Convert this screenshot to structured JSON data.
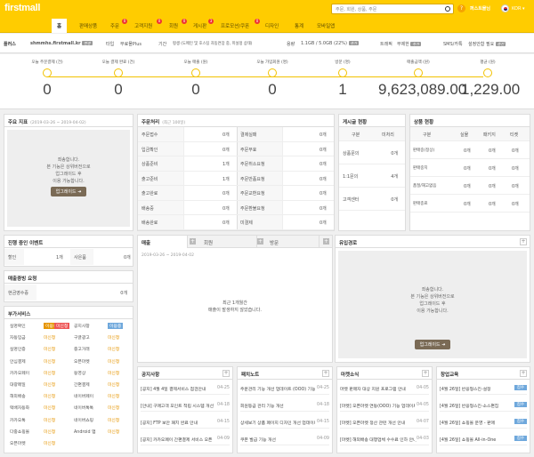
{
  "header": {
    "logo": "firstmall",
    "search_placeholder": "주문, 회원, 상품, 주문",
    "help": "?",
    "user": "퍼스트몰님",
    "lang": "KOR ▾",
    "brand_color": "#ffcc00"
  },
  "nav": [
    {
      "label": "홈"
    },
    {
      "label": "판매상품"
    },
    {
      "label": "주문",
      "badge": "0"
    },
    {
      "label": "고객지원",
      "badge": "0"
    },
    {
      "label": "회원",
      "badge": "0"
    },
    {
      "label": "게시판",
      "badge": "3"
    },
    {
      "label": "프로모션/쿠폰",
      "badge": "0"
    },
    {
      "label": "디자인"
    },
    {
      "label": "통계"
    },
    {
      "label": "모바일앱"
    }
  ],
  "info": {
    "plan": "플러스",
    "domain": "shmmhs.firstmall.kr",
    "domain_tag": "변경",
    "type_label": "타입",
    "type_value": "무료몰Plus",
    "period_label": "기간",
    "period_value": "평생 (도메인 및 호스팅 자동연장 중, 미설정 상태)",
    "capacity_label": "용량",
    "capacity_value": "1.1GB / 5.0GB (22%)",
    "capacity_tag": "추가",
    "traffic_label": "트래픽",
    "traffic_value": "무제한",
    "traffic_tag": "추가",
    "sms_label": "SMS/카톡",
    "sms_value": "설정안함 필요",
    "sms_tag": "충전"
  },
  "stats": [
    {
      "label": "오늘 주문결제 (건)",
      "value": "0"
    },
    {
      "label": "오늘 결제 완료 (건)",
      "value": "0"
    },
    {
      "label": "오늘 매출 (원)",
      "value": "0"
    },
    {
      "label": "오늘 가입회원 (명)",
      "value": "0"
    },
    {
      "label": "방문 (명)",
      "value": "1"
    },
    {
      "label": "매출금액 (원)",
      "value": "9,623,089.00"
    },
    {
      "label": "평균 (원)",
      "value": "1,229.00"
    }
  ],
  "upgrade": {
    "msg1": "죄송합니다.",
    "msg2": "본 기능은 상위버전으로",
    "msg3": "업그레이드 후",
    "msg4": "이용 가능합니다.",
    "button": "업그레이드 ➜"
  },
  "main_metrics": {
    "title": "주요 지표",
    "date": "(2019-03-26 ~ 2019-04-02)"
  },
  "order_process": {
    "title": "주문처리",
    "subtitle": "(최근 100일)",
    "left": [
      {
        "label": "주문접수",
        "value": "0개"
      },
      {
        "label": "입금확인",
        "value": "0개"
      },
      {
        "label": "상품준비",
        "value": "1개"
      },
      {
        "label": "출고준비",
        "value": "1개"
      },
      {
        "label": "출고완료",
        "value": "0개"
      },
      {
        "label": "배송중",
        "value": "0개"
      },
      {
        "label": "배송완료",
        "value": "0개"
      }
    ],
    "right": [
      {
        "label": "결제실패",
        "value": "0개"
      },
      {
        "label": "주문무효",
        "value": "0개"
      },
      {
        "label": "주문취소요청",
        "value": "0개"
      },
      {
        "label": "주문반품요청",
        "value": "0개"
      },
      {
        "label": "주문교환요청",
        "value": "0개"
      },
      {
        "label": "주문환불요청",
        "value": "0개"
      },
      {
        "label": "미결제",
        "value": "0개"
      }
    ]
  },
  "board_status": {
    "title": "게시글 현황",
    "col1": "구분",
    "col2": "미처리",
    "rows": [
      {
        "label": "상품문의",
        "value": "0개"
      },
      {
        "label": "1:1문의",
        "value": "4개"
      },
      {
        "label": "고객센터",
        "value": "0개"
      }
    ]
  },
  "product_status": {
    "title": "상품 현황",
    "cols": [
      "구분",
      "실물",
      "패키지",
      "티켓"
    ],
    "rows": [
      {
        "label": "판매중(정상)",
        "a": "0개",
        "b": "0개",
        "c": "0개"
      },
      {
        "label": "판매중지",
        "a": "0개",
        "b": "0개",
        "c": "0개"
      },
      {
        "label": "품절/재고없음",
        "a": "0개",
        "b": "0개",
        "c": "0개"
      },
      {
        "label": "판매종료",
        "a": "0개",
        "b": "0개",
        "c": "0개"
      }
    ]
  },
  "events": {
    "title": "진행 중인 이벤트",
    "rows": [
      {
        "label": "할인",
        "value": "1개"
      },
      {
        "label": "사은품",
        "value": "0개"
      }
    ]
  },
  "sales_request": {
    "title": "매출증빙 요청",
    "row_label": "현금영수증",
    "row_value": "0개"
  },
  "services": {
    "title": "부가서비스",
    "left": [
      {
        "label": "실명확인",
        "state": "이용중",
        "state2": "미신청"
      },
      {
        "label": "자동입금",
        "state": "미신청"
      },
      {
        "label": "실명인증",
        "state": "미신청"
      },
      {
        "label": "안심결제",
        "state": "미신청"
      },
      {
        "label": "카카오페이",
        "state": "미신청"
      },
      {
        "label": "대량메일",
        "state": "미신청"
      },
      {
        "label": "해외배송",
        "state": "미신청"
      },
      {
        "label": "택배자동화",
        "state": "미신청"
      },
      {
        "label": "카카오톡",
        "state": "미신청"
      },
      {
        "label": "다중쇼핑몰",
        "state": "미신청"
      },
      {
        "label": "오픈마켓",
        "state": "미신청"
      }
    ],
    "right": [
      {
        "label": "공지사항",
        "state": "이용중"
      },
      {
        "label": "구글광고",
        "state": "미신청"
      },
      {
        "label": "중고거래",
        "state": "미신청"
      },
      {
        "label": "오픈마켓",
        "state": "미신청"
      },
      {
        "label": "동영상",
        "state": "미신청"
      },
      {
        "label": "간편결제",
        "state": "미신청"
      },
      {
        "label": "네이버페이",
        "state": "미신청"
      },
      {
        "label": "네이버톡톡",
        "state": "미신청"
      },
      {
        "label": "네이버쇼핑",
        "state": "미신청"
      },
      {
        "label": "Android 앱",
        "state": "미신청"
      }
    ]
  },
  "sales": {
    "tabs": [
      "매출",
      "회원",
      "방문"
    ],
    "date": "2019-03-26 ~ 2019-04-02",
    "empty1": "최근 1개월간",
    "empty2": "매출이 발생하지 않았습니다."
  },
  "inflow": {
    "title": "유입경로"
  },
  "notice": {
    "title": "공지사항",
    "items": [
      {
        "text": "[공지] 4월 4일 결제서비스 점검안내",
        "date": "04-25"
      },
      {
        "text": "[안내] 구매고객 포인트 적립 시스템 개선",
        "date": "04-18"
      },
      {
        "text": "[공지] FTP 보안 패치 완료 안내",
        "date": "04-15"
      },
      {
        "text": "[공지] 카카오페이 간편결제 서비스 오픈",
        "date": "04-09"
      }
    ]
  },
  "patch": {
    "title": "패치노트",
    "items": [
      {
        "text": "주문관리 기능 개선 업데이트 (OOO) 기능",
        "date": "04-25"
      },
      {
        "text": "회원등급 관리 기능 개선",
        "date": "04-18"
      },
      {
        "text": "상세보기 상품 페이지 디자인 개선 업데이트",
        "date": "04-15"
      },
      {
        "text": "쿠폰 발급 기능 개선",
        "date": "04-09"
      }
    ]
  },
  "market": {
    "title": "마켓소식",
    "items": [
      {
        "text": "마켓 판매자 대상 지원 프로그램 안내",
        "date": "04-05"
      },
      {
        "text": "[마켓] 오픈마켓 연동(OOO) 기능 업데이트",
        "date": "04-05"
      },
      {
        "text": "[마켓] 오픈마켓 정산 관련 개선 안내",
        "date": "04-07"
      },
      {
        "text": "[마켓] 해외배송 대행업체 수수료 인하 안내",
        "date": "04-03"
      }
    ]
  },
  "edu": {
    "title": "창업교육",
    "items": [
      {
        "text": "[4월 26일] 반응형스킨-설정",
        "tag": "접수"
      },
      {
        "text": "[4월 26일] 반응형스킨-소스편집",
        "tag": "접수"
      },
      {
        "text": "[4월 26일] 쇼핑몰 운영 - 판매",
        "tag": "접수"
      },
      {
        "text": "[4월 26일] 쇼핑몰 All-in-One",
        "tag": "접수"
      }
    ]
  }
}
